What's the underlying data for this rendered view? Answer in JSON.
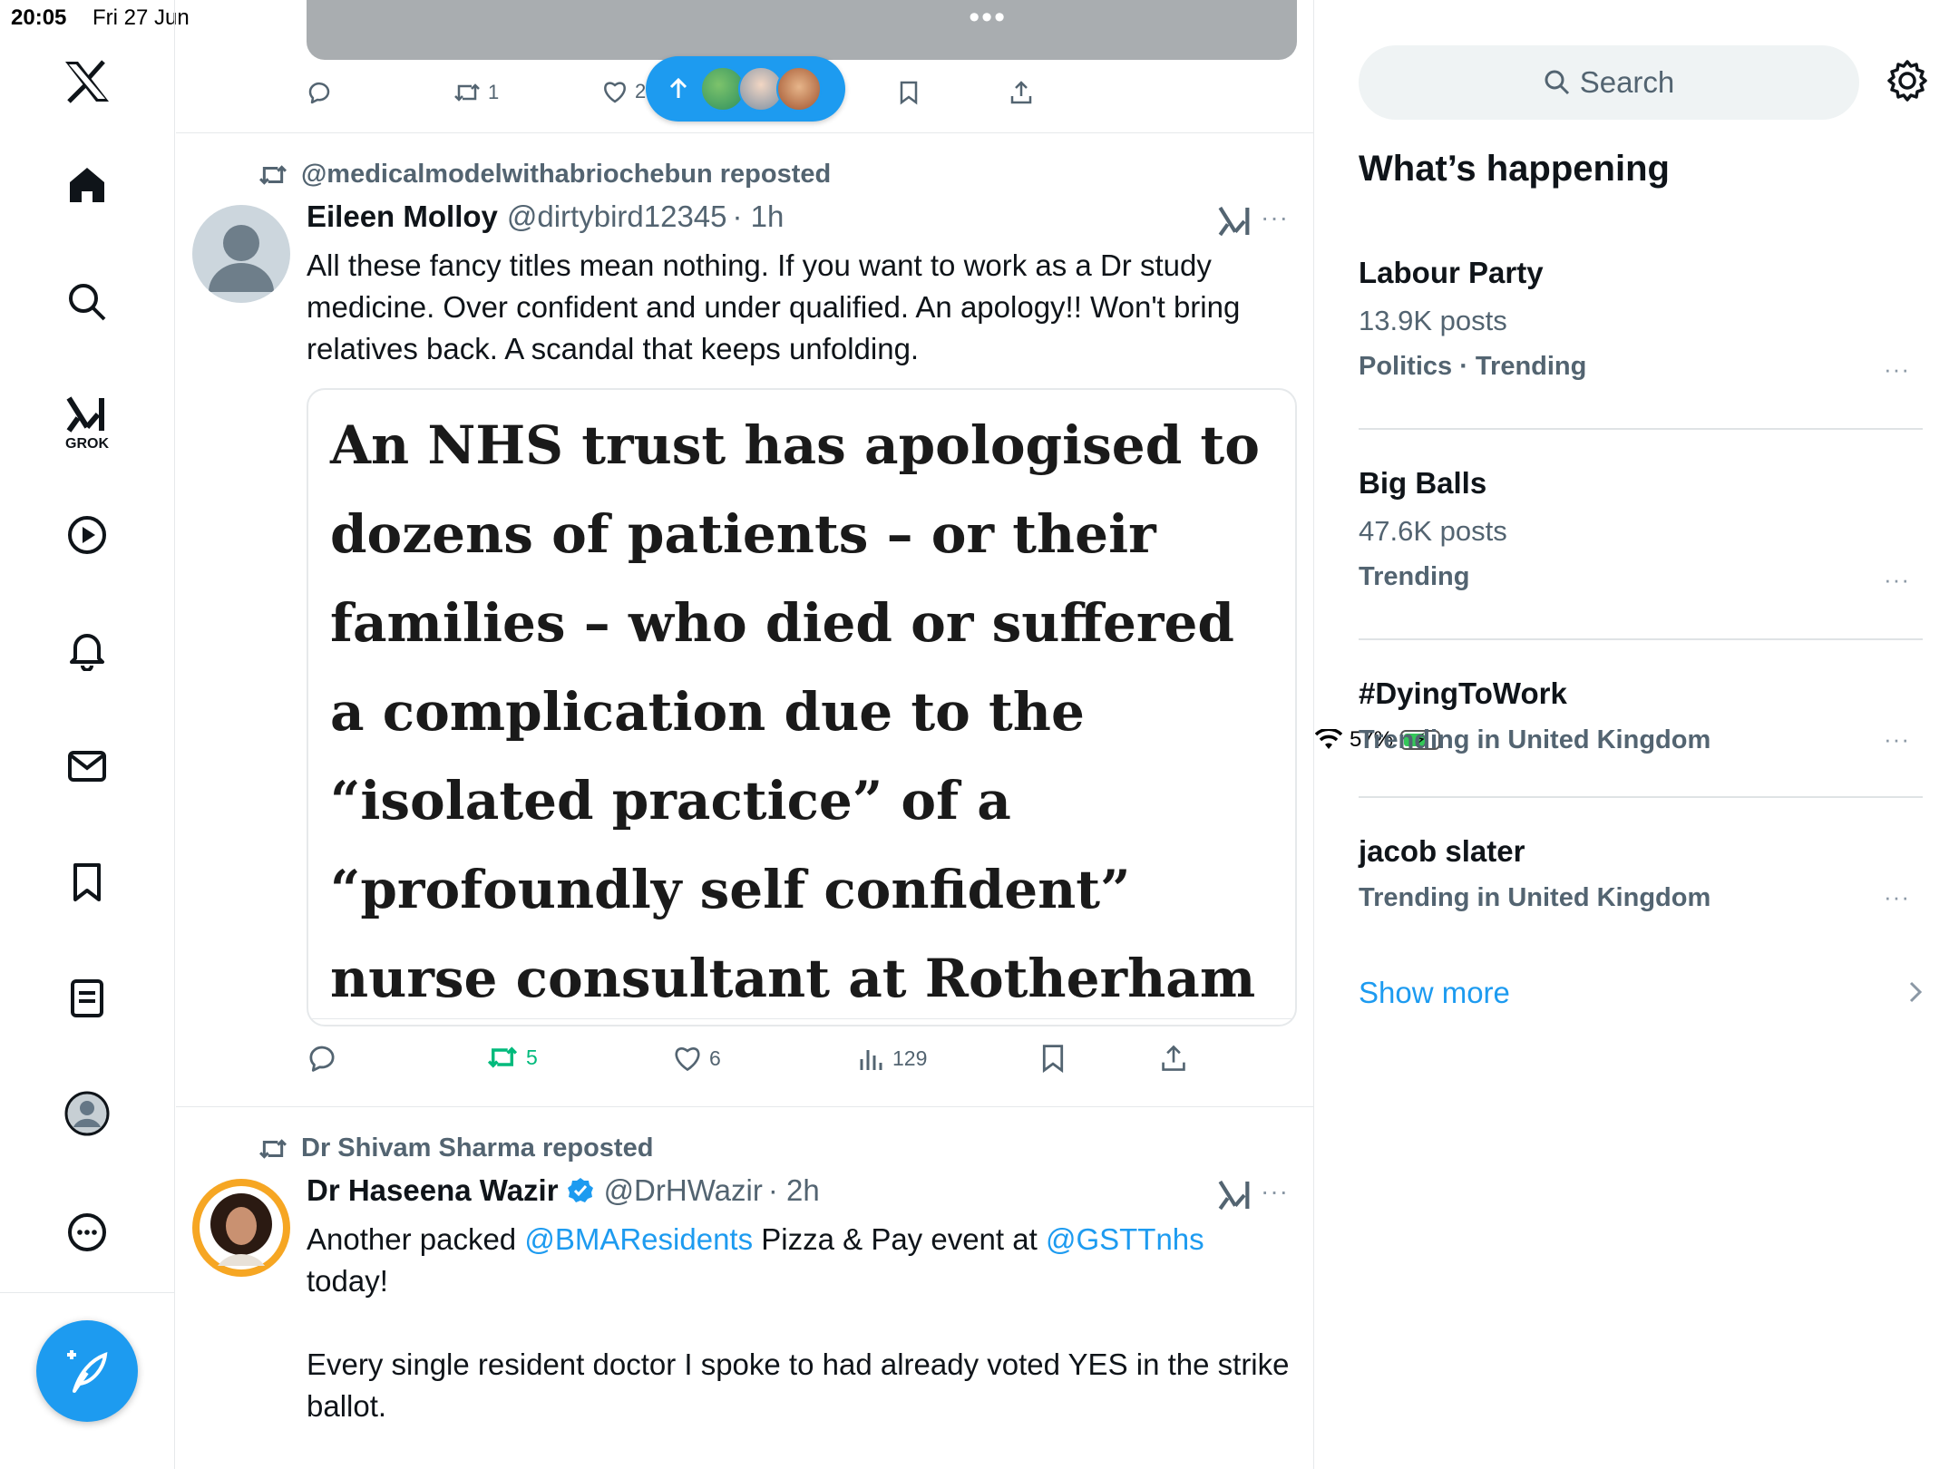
{
  "status_bar": {
    "time": "20:05",
    "date": "Fri 27 Jun",
    "battery": "57%",
    "battery_level": 0.57
  },
  "nav": {
    "grok_label": "GROK",
    "icons": [
      "x-logo-icon",
      "home-icon",
      "search-icon",
      "grok-icon",
      "video-icon",
      "notifications-icon",
      "messages-icon",
      "bookmarks-icon",
      "lists-icon",
      "profile-icon",
      "more-icon"
    ]
  },
  "top_post": {
    "media_more": "•••",
    "retweet_count": "1",
    "like_count": "2"
  },
  "tweet1": {
    "repost_by": "@medicalmodelwithabriochebun reposted",
    "name": "Eileen Molloy",
    "handle": "@dirtybird12345",
    "time": "· 1h",
    "text": "All these fancy titles mean nothing. If you want to work as a Dr study medicine. Over confident and under qualified. An apology!! Won't bring relatives back. A scandal that keeps unfolding.",
    "quote_headline": "An NHS trust has apologised to dozens of patients – or their families – who died or suffered a complication due to the “isolated practice” of a “profoundly self confident” nurse consultant at Rotherham Hospital.",
    "retweets": "5",
    "likes": "6",
    "views": "129",
    "more": "···"
  },
  "tweet2": {
    "repost_by": "Dr Shivam Sharma reposted",
    "name": "Dr Haseena Wazir",
    "handle": "@DrHWazir",
    "time": "· 2h",
    "text_pre": "Another packed ",
    "mention1": "@BMAResidents",
    "text_mid": " Pizza & Pay event at ",
    "mention2": "@GSTTnhs",
    "text_line2": "today!",
    "text_para2": "Every single resident doctor I spoke to had already voted YES in the strike ballot.",
    "more": "···"
  },
  "sidebar": {
    "search_placeholder": "Search",
    "heading": "What’s happening",
    "trends": [
      {
        "name": "Labour Party",
        "count": "13.9K posts",
        "context": "Politics · Trending"
      },
      {
        "name": "Big Balls",
        "count": "47.6K posts",
        "context": "Trending"
      },
      {
        "name": "#DyingToWork",
        "count": "",
        "context": "Trending in United Kingdom"
      },
      {
        "name": "jacob slater",
        "count": "",
        "context": "Trending in United Kingdom"
      }
    ],
    "more": "···",
    "show_more": "Show more"
  },
  "colors": {
    "accent": "#1d9bf0",
    "retweet_green": "#00ba7c",
    "text_secondary": "#536471"
  }
}
